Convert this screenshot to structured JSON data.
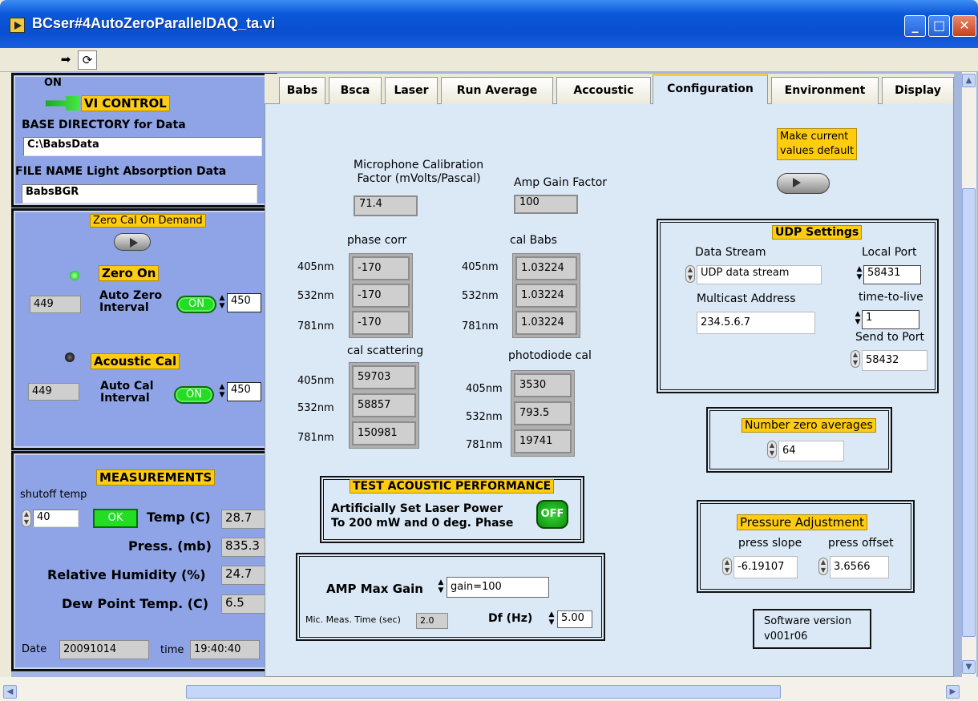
{
  "window": {
    "title": "BCser#4AutoZeroParallelDAQ_ta.vi"
  },
  "vi_control": {
    "on_label": "ON",
    "title": "VI CONTROL",
    "base_dir_label": "BASE DIRECTORY for Data",
    "base_dir_value": "C:\\BabsData",
    "file_name_label": "FILE NAME Light Absorption Data",
    "file_name_value": "BabsBGR"
  },
  "zero_cal": {
    "on_demand_label": "Zero Cal On Demand",
    "zero_on_label": "Zero On",
    "zero_count": "449",
    "auto_zero_label_1": "Auto Zero",
    "auto_zero_label_2": "Interval",
    "auto_zero_switch": "ON",
    "auto_zero_interval": "450",
    "acoustic_cal_label": "Acoustic Cal",
    "acoustic_count": "449",
    "auto_cal_label_1": "Auto Cal",
    "auto_cal_label_2": "Interval",
    "auto_cal_switch": "ON",
    "auto_cal_interval": "450"
  },
  "measurements": {
    "title": "MEASUREMENTS",
    "shutoff_label": "shutoff temp",
    "shutoff_value": "40",
    "ok_label": "OK",
    "temp_label": "Temp (C)",
    "temp_value": "28.7",
    "press_label": "Press. (mb)",
    "press_value": "835.3",
    "rh_label": "Relative Humidity (%)",
    "rh_value": "24.7",
    "dew_label": "Dew Point Temp. (C)",
    "dew_value": "6.5",
    "date_label": "Date",
    "date_value": "20091014",
    "time_label": "time",
    "time_value": "19:40:40"
  },
  "tabs": [
    {
      "label": "Babs"
    },
    {
      "label": "Bsca"
    },
    {
      "label": "Laser"
    },
    {
      "label": "Run Average"
    },
    {
      "label": "Accoustic"
    },
    {
      "label": "Configuration"
    },
    {
      "label": "Environment"
    },
    {
      "label": "Display"
    }
  ],
  "config": {
    "mic_cal_label_1": "Microphone Calibration",
    "mic_cal_label_2": "Factor (mVolts/Pascal)",
    "mic_cal_value": "71.4",
    "amp_gain_label": "Amp Gain Factor",
    "amp_gain_value": "100",
    "phase_corr_label": "phase corr",
    "cal_babs_label": "cal Babs",
    "cal_scatter_label": "cal scattering",
    "photodiode_label": "photodiode cal",
    "wl": [
      "405nm",
      "532nm",
      "781nm"
    ],
    "phase_corr": [
      "-170",
      "-170",
      "-170"
    ],
    "cal_babs": [
      "1.03224",
      "1.03224",
      "1.03224"
    ],
    "cal_scatter": [
      "59703",
      "58857",
      "150981"
    ],
    "photodiode": [
      "3530",
      "793.5",
      "19741"
    ],
    "make_default_1": "Make current",
    "make_default_2": "values default",
    "test_title": "TEST ACOUSTIC PERFORMANCE",
    "test_text_1": "Artificially Set Laser Power",
    "test_text_2": "To 200 mW and 0 deg. Phase",
    "test_switch": "OFF",
    "amp_max_label": "AMP Max Gain",
    "amp_max_value": "gain=100",
    "mic_time_label": "Mic. Meas. Time (sec)",
    "mic_time_value": "2.0",
    "df_label": "Df (Hz)",
    "df_value": "5.00",
    "udp_title": "UDP Settings",
    "data_stream_label": "Data Stream",
    "data_stream_value": "UDP data stream",
    "local_port_label": "Local Port",
    "local_port_value": "58431",
    "multicast_label": "Multicast Address",
    "multicast_value": "234.5.6.7",
    "ttl_label": "time-to-live",
    "ttl_value": "1",
    "send_port_label": "Send to Port",
    "send_port_value": "58432",
    "zero_avg_label": "Number zero averages",
    "zero_avg_value": "64",
    "pressure_title": "Pressure Adjustment",
    "press_slope_label": "press slope",
    "press_slope_value": "-6.19107",
    "press_offset_label": "press offset",
    "press_offset_value": "3.6566",
    "sw_label": "Software version",
    "sw_value": "v001r06"
  },
  "colors": {
    "panel": "#8ea4e6",
    "tab_page": "#dbe9f7",
    "led_on": "#33dd33",
    "label_yellow": "#ffcc11"
  }
}
